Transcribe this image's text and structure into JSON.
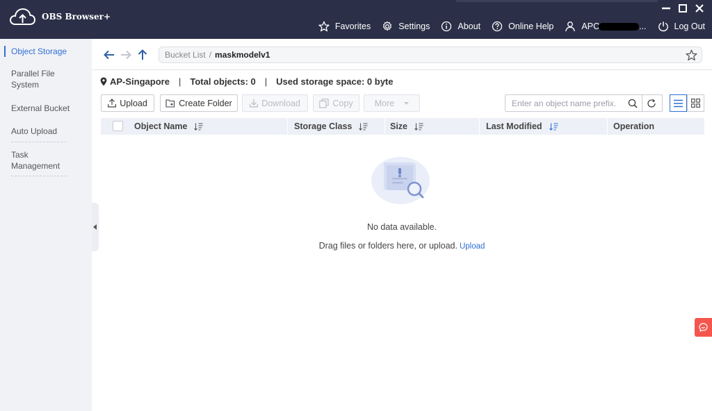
{
  "app": {
    "title": "OBS Browser+"
  },
  "topnav": {
    "favorites": "Favorites",
    "settings": "Settings",
    "about": "About",
    "help": "Online Help",
    "user_prefix": "APC",
    "user_suffix": "...",
    "logout": "Log Out"
  },
  "sidebar": {
    "items": [
      {
        "label": "Object Storage",
        "active": true
      },
      {
        "label": "Parallel File System"
      },
      {
        "label": "External Bucket"
      },
      {
        "label": "Auto Upload"
      },
      {
        "label": "Task Management"
      }
    ]
  },
  "breadcrumb": {
    "root": "Bucket List",
    "separator": "/",
    "current": "maskmodelv1"
  },
  "info": {
    "region": "AP-Singapore",
    "total_objects": "Total objects: 0",
    "used_storage": "Used storage space: 0 byte"
  },
  "toolbar": {
    "upload": "Upload",
    "create_folder": "Create Folder",
    "download": "Download",
    "copy": "Copy",
    "more": "More",
    "search_placeholder": "Enter an object name prefix."
  },
  "table": {
    "columns": [
      "Object Name",
      "Storage Class",
      "Size",
      "Last Modified",
      "Operation"
    ],
    "rows": []
  },
  "empty_state": {
    "message": "No data available.",
    "hint": "Drag files or folders here, or upload.",
    "link": "Upload"
  },
  "colors": {
    "titlebar": "#2b3048",
    "accent": "#2f6fd6",
    "sidebar_bg": "#f1f2f6",
    "chat_button": "#f4564e"
  }
}
